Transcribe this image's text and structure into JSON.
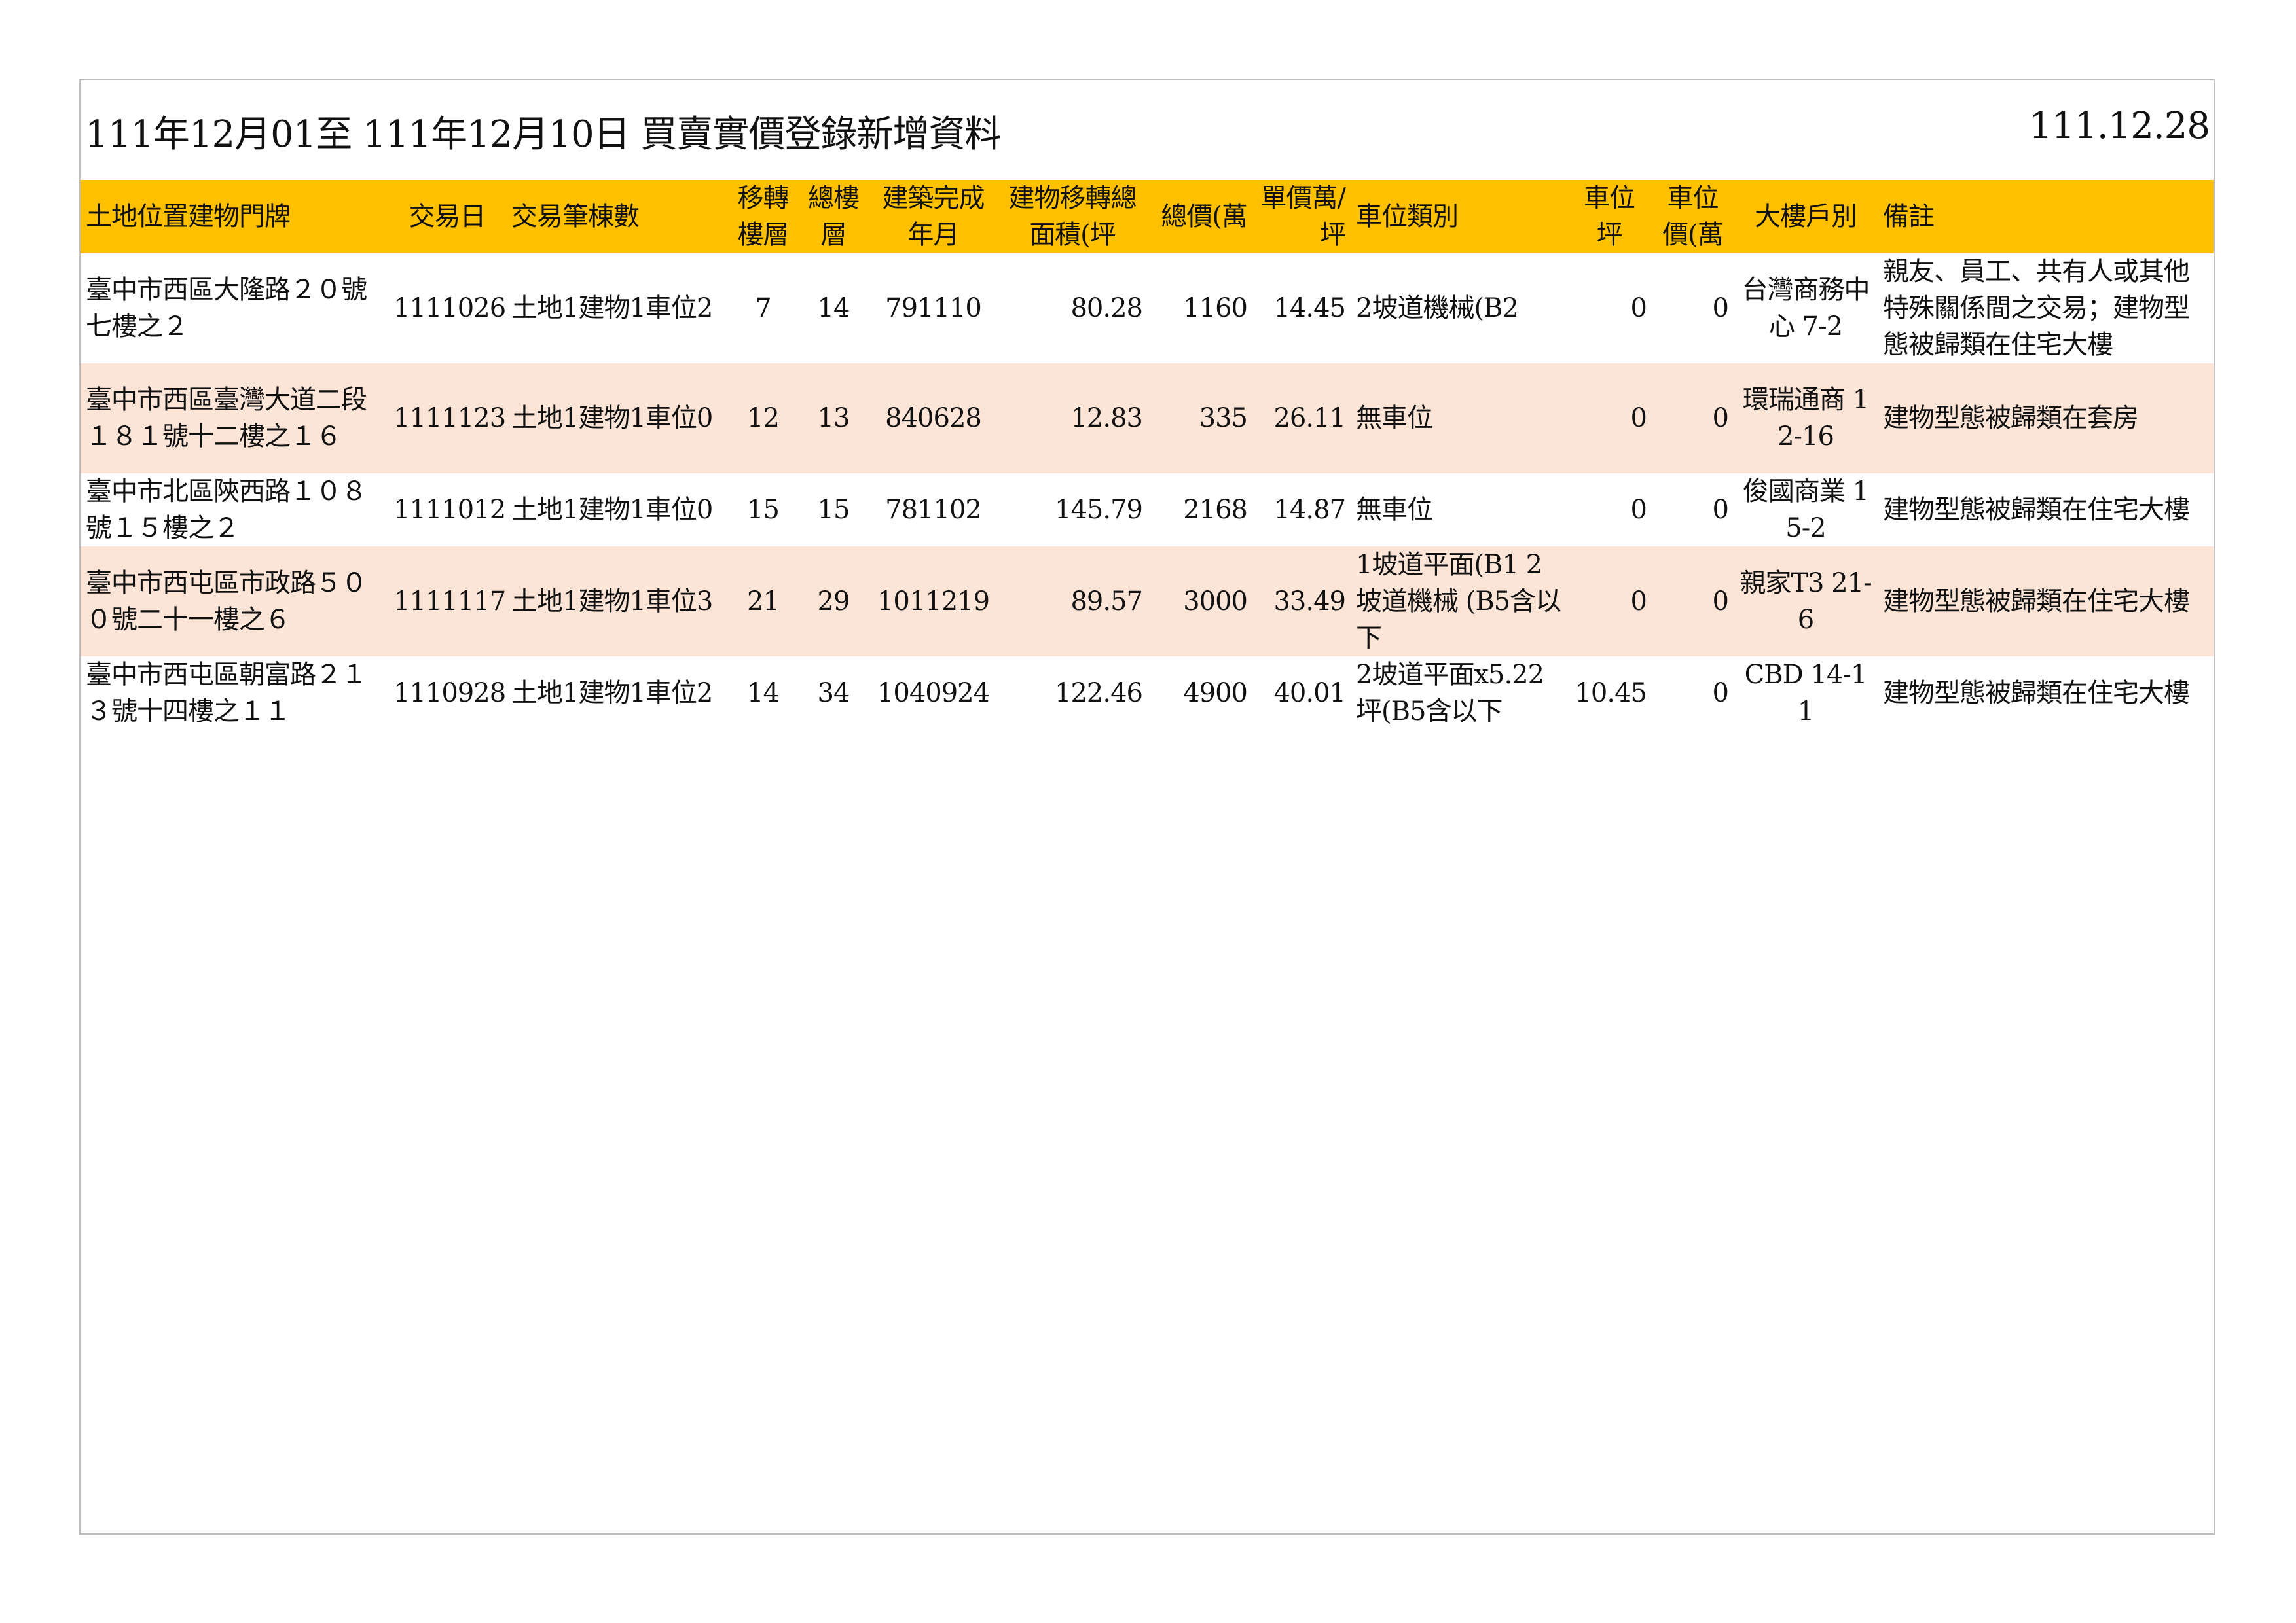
{
  "document": {
    "title": "111年12月01至 111年12月10日  買賣實價登錄新增資料",
    "date": "111.12.28"
  },
  "table": {
    "headers": [
      "土地位置建物門牌",
      "交易日",
      "交易筆棟數",
      "移轉樓層",
      "總樓層",
      "建築完成年月",
      "建物移轉總面積(坪",
      "總價(萬",
      "單價萬/坪",
      "車位類別",
      "車位坪",
      "車位價(萬",
      "大樓戶別",
      "備註"
    ],
    "rows": [
      {
        "address": "臺中市西區大隆路２０號七樓之２",
        "date": "1111026",
        "units": "土地1建物1車位2",
        "floor": "7",
        "total_floors": "14",
        "built": "791110",
        "area": "80.28",
        "total_price": "1160",
        "unit_price": "14.45",
        "parking_type": "2坡道機械(B2",
        "parking_area": "0",
        "parking_price": "0",
        "building": "台灣商務中心 7-2",
        "note": "親友、員工、共有人或其他特殊關係間之交易；建物型態被歸類在住宅大樓"
      },
      {
        "address": "臺中市西區臺灣大道二段１８１號十二樓之１６",
        "date": "1111123",
        "units": "土地1建物1車位0",
        "floor": "12",
        "total_floors": "13",
        "built": "840628",
        "area": "12.83",
        "total_price": "335",
        "unit_price": "26.11",
        "parking_type": "無車位",
        "parking_area": "0",
        "parking_price": "0",
        "building": "環瑞通商 12-16",
        "note": "建物型態被歸類在套房"
      },
      {
        "address": "臺中市北區陝西路１０８號１５樓之２",
        "date": "1111012",
        "units": "土地1建物1車位0",
        "floor": "15",
        "total_floors": "15",
        "built": "781102",
        "area": "145.79",
        "total_price": "2168",
        "unit_price": "14.87",
        "parking_type": "無車位",
        "parking_area": "0",
        "parking_price": "0",
        "building": "俊國商業 15-2",
        "note": "建物型態被歸類在住宅大樓"
      },
      {
        "address": "臺中市西屯區市政路５００號二十一樓之６",
        "date": "1111117",
        "units": "土地1建物1車位3",
        "floor": "21",
        "total_floors": "29",
        "built": "1011219",
        "area": "89.57",
        "total_price": "3000",
        "unit_price": "33.49",
        "parking_type": "1坡道平面(B1 2坡道機械 (B5含以下",
        "parking_area": "0",
        "parking_price": "0",
        "building": "親家T3 21-6",
        "note": "建物型態被歸類在住宅大樓"
      },
      {
        "address": "臺中市西屯區朝富路２１３號十四樓之１１",
        "date": "1110928",
        "units": "土地1建物1車位2",
        "floor": "14",
        "total_floors": "34",
        "built": "1040924",
        "area": "122.46",
        "total_price": "4900",
        "unit_price": "40.01",
        "parking_type": "2坡道平面x5.22坪(B5含以下",
        "parking_area": "10.45",
        "parking_price": "0",
        "building": "CBD 14-11",
        "note": "建物型態被歸類在住宅大樓"
      }
    ]
  }
}
